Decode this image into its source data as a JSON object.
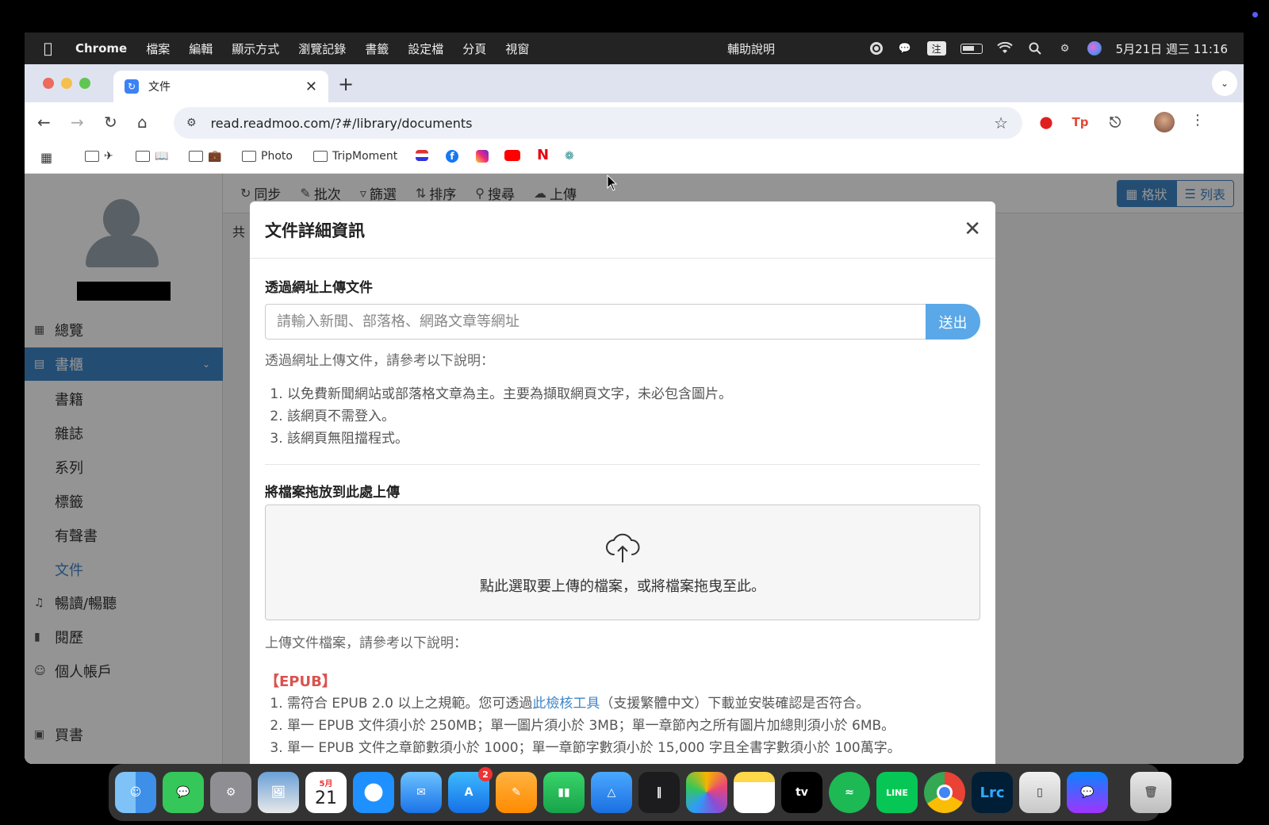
{
  "menubar": {
    "apple": "",
    "app_name": "Chrome",
    "items": [
      "檔案",
      "編輯",
      "顯示方式",
      "瀏覽記錄",
      "書籤",
      "設定檔",
      "分頁",
      "視窗"
    ],
    "help": "輔助說明",
    "input_method": "注",
    "clock": "5月21日 週三 11:16"
  },
  "browser": {
    "tab_title": "文件",
    "tab_close": "✕",
    "new_tab": "+",
    "url": "read.readmoo.com/?#/library/documents",
    "bookmarks": [
      "Photo",
      "TripMoment"
    ],
    "ext_tp": "Tp"
  },
  "sidebar": {
    "overview": "總覽",
    "bookshelf": "書櫃",
    "sub_items": [
      "書籍",
      "雜誌",
      "系列",
      "標籤",
      "有聲書",
      "文件"
    ],
    "read_listen": "暢讀/暢聽",
    "history": "閱歷",
    "account": "個人帳戶",
    "buy": "買書"
  },
  "content_toolbar": {
    "items": [
      "同步",
      "批次",
      "篩選",
      "排序",
      "搜尋",
      "上傳"
    ],
    "view_grid": "格狀",
    "view_list": "列表",
    "count_prefix": "共"
  },
  "modal": {
    "title": "文件詳細資訊",
    "url_section_title": "透過網址上傳文件",
    "url_placeholder": "請輸入新聞、部落格、網路文章等網址",
    "send_label": "送出",
    "url_help": "透過網址上傳文件，請參考以下說明：",
    "url_rules": [
      "以免費新聞網站或部落格文章為主。主要為擷取網頁文字，未必包含圖片。",
      "該網頁不需登入。",
      "該網頁無阻擋程式。"
    ],
    "file_section_title": "將檔案拖放到此處上傳",
    "dropzone_text": "點此選取要上傳的檔案，或將檔案拖曳至此。",
    "file_help": "上傳文件檔案，請參考以下說明：",
    "epub_head": "【EPUB】",
    "epub_rule1_pre": "需符合 EPUB 2.0 以上之規範。您可透過",
    "epub_rule1_link": "此檢核工具",
    "epub_rule1_post": "（支援繁體中文）下載並安裝確認是否符合。",
    "epub_rule2": "單一 EPUB 文件須小於 250MB；單一圖片須小於 3MB；單一章節內之所有圖片加總則須小於 6MB。",
    "epub_rule3": "單一 EPUB 文件之章節數須小於 1000；單一章節字數須小於 15,000 字且全書字數須小於 100萬字。"
  },
  "dock": {
    "calendar_month": "5月",
    "calendar_day": "21",
    "appstore_badge": "2",
    "tv_label": "tv",
    "line_label": "LINE",
    "lrc_label": "Lrc"
  }
}
